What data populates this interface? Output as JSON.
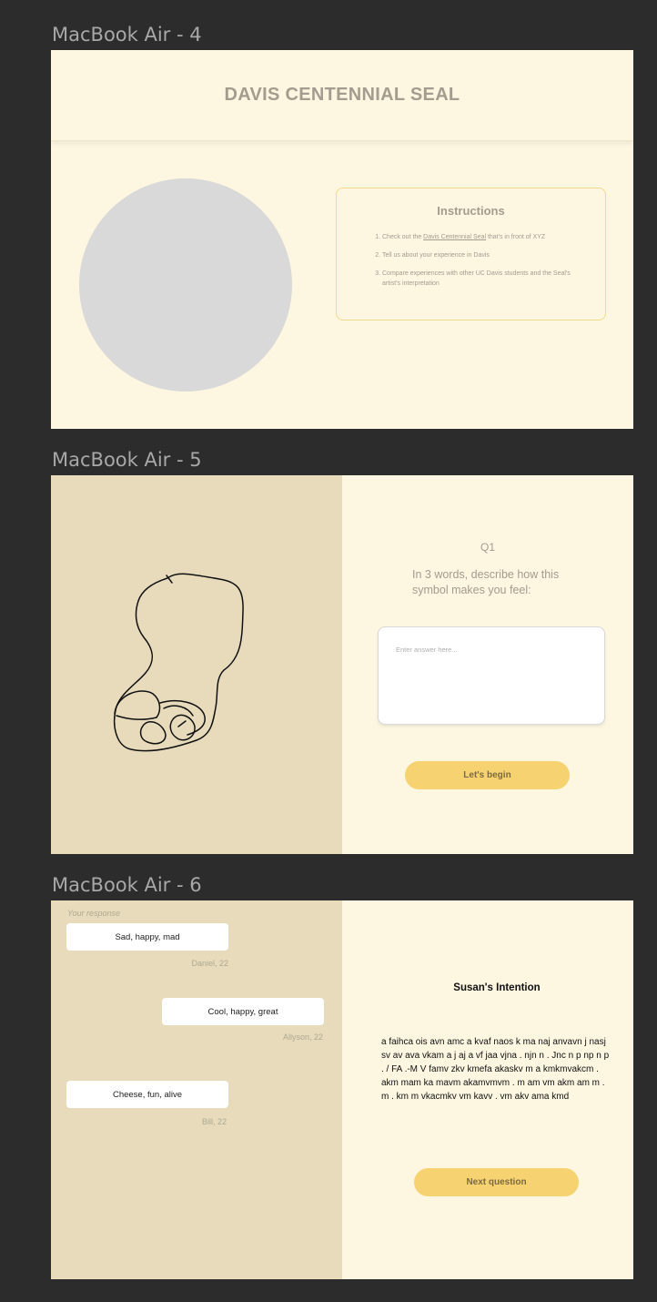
{
  "frames": {
    "f4": {
      "label": "MacBook Air - 4"
    },
    "f5": {
      "label": "MacBook Air - 5"
    },
    "f6": {
      "label": "MacBook Air - 6"
    }
  },
  "page4": {
    "title": "DAVIS CENTENNIAL SEAL",
    "instructions": {
      "heading": "Instructions",
      "item1_pre": "Check out the ",
      "item1_link": "Davis Centennial Seal",
      "item1_post": " that's in front of XYZ",
      "item2": "Tell us about your experience in Davis",
      "item3": "Compare experiences with other UC Davis students and the Seal's artist's interpretation"
    }
  },
  "page5": {
    "question_label": "Q1",
    "question_text": "In 3 words, describe how this symbol makes you feel:",
    "answer_placeholder": "Enter answer here...",
    "begin_label": "Let's begin"
  },
  "page6": {
    "your_response": "Your response",
    "responses": [
      {
        "text": "Sad, happy, mad",
        "author": "Daniel, 22"
      },
      {
        "text": "Cool, happy, great",
        "author": "Allyson, 22"
      },
      {
        "text": "Cheese, fun, alive",
        "author": "Bill, 22"
      }
    ],
    "intention_title": "Susan's Intention",
    "intention_body": "a faihca ois avn amc a kvaf naos k ma naj anvavn j nasj sv av ava vkam a j aj a vf jaa vjna . njn n . Jnc n p np n p . / FA .-M V  famv zkv kmefa akaskv m a kmkmvakcm . akm mam ka mavm akamvmvm . m am vm akm am m . m . km m vkacmkv   vm kavv .  vm akv ama kmd",
    "next_label": "Next question"
  },
  "colors": {
    "cream": "#fdf6e1",
    "tan": "#e7dbbc",
    "accent": "#f6d370",
    "seal_gray": "#d9d9d9",
    "muted_text": "#a39c8f"
  }
}
